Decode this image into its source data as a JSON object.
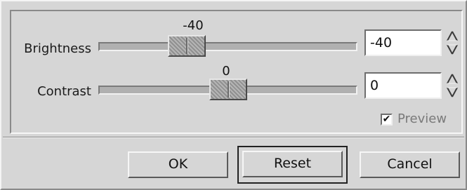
{
  "brightness": {
    "label": "Brightness",
    "value_display": "-40",
    "entry_value": "-40",
    "min": -127,
    "max": 127,
    "value": -40
  },
  "contrast": {
    "label": "Contrast",
    "value_display": "0",
    "entry_value": "0",
    "min": -127,
    "max": 127,
    "value": 0
  },
  "preview": {
    "label": "Preview",
    "checked": true,
    "check_glyph": "✔"
  },
  "buttons": {
    "ok": "OK",
    "reset": "Reset",
    "cancel": "Cancel"
  },
  "icons": {
    "spin": "spin-up-down-arrows-icon",
    "check": "checkmark-icon"
  },
  "colors": {
    "dialog_bg": "#d6d6d6",
    "trough": "#b0b0b0",
    "thumb": "#9c9c9c",
    "disabled_text": "#7a7a7a"
  }
}
